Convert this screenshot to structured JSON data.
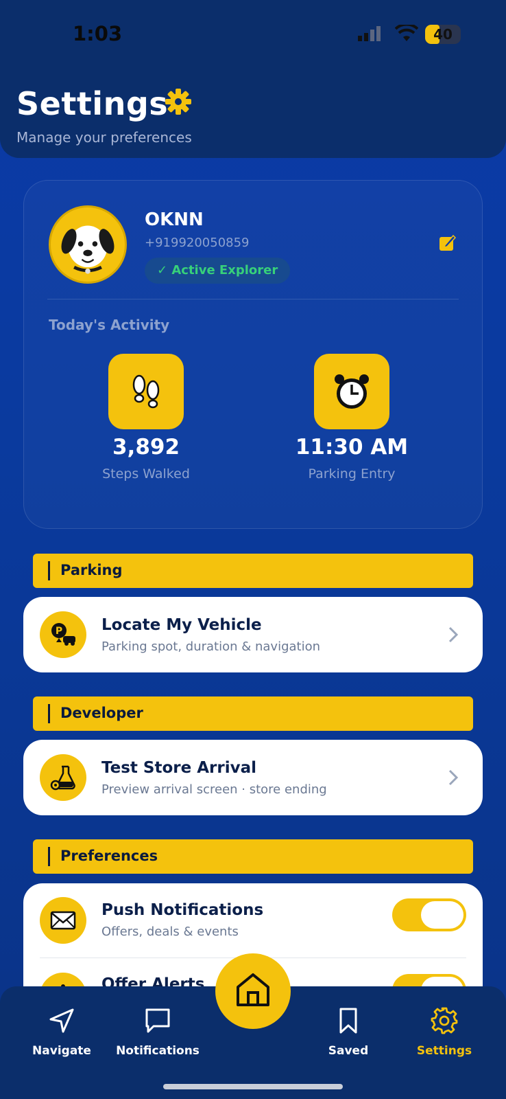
{
  "status_bar": {
    "time": "1:03",
    "battery": "40",
    "battery_level": 0.4
  },
  "header": {
    "title": "Settings",
    "subtitle": "Manage your preferences"
  },
  "profile": {
    "name": "OKNN",
    "phone": "+919920050859",
    "badge": "✓ Active Explorer",
    "activity_title": "Today's Activity",
    "stats": [
      {
        "icon": "footprints-icon",
        "value": "3,892",
        "label": "Steps Walked"
      },
      {
        "icon": "alarm-clock-icon",
        "value": "11:30 AM",
        "label": "Parking Entry"
      }
    ]
  },
  "sections": {
    "parking": {
      "title": "Parking",
      "item": {
        "icon": "parking-car-icon",
        "title": "Locate My Vehicle",
        "subtitle": "Parking spot, duration & navigation"
      }
    },
    "developer": {
      "title": "Developer",
      "item": {
        "icon": "flask-gear-icon",
        "title": "Test Store Arrival",
        "subtitle": "Preview arrival screen · store ending"
      }
    },
    "preferences": {
      "title": "Preferences",
      "items": [
        {
          "icon": "envelope-icon",
          "title": "Push Notifications",
          "subtitle": "Offers, deals & events",
          "enabled": true
        },
        {
          "icon": "bell-icon",
          "title": "Offer Alerts",
          "subtitle": "",
          "enabled": true
        }
      ]
    }
  },
  "nav": {
    "items": [
      {
        "label": "Navigate",
        "icon": "navigate-arrow-icon"
      },
      {
        "label": "Notifications",
        "icon": "chat-bubble-icon"
      },
      {
        "label": "Saved",
        "icon": "bookmark-icon"
      },
      {
        "label": "Settings",
        "icon": "gear-icon"
      }
    ],
    "home_icon": "home-icon"
  },
  "colors": {
    "accent": "#f4c20d",
    "header": "#0b2e6b",
    "background": "#0b3aa8",
    "success": "#37d07a"
  }
}
